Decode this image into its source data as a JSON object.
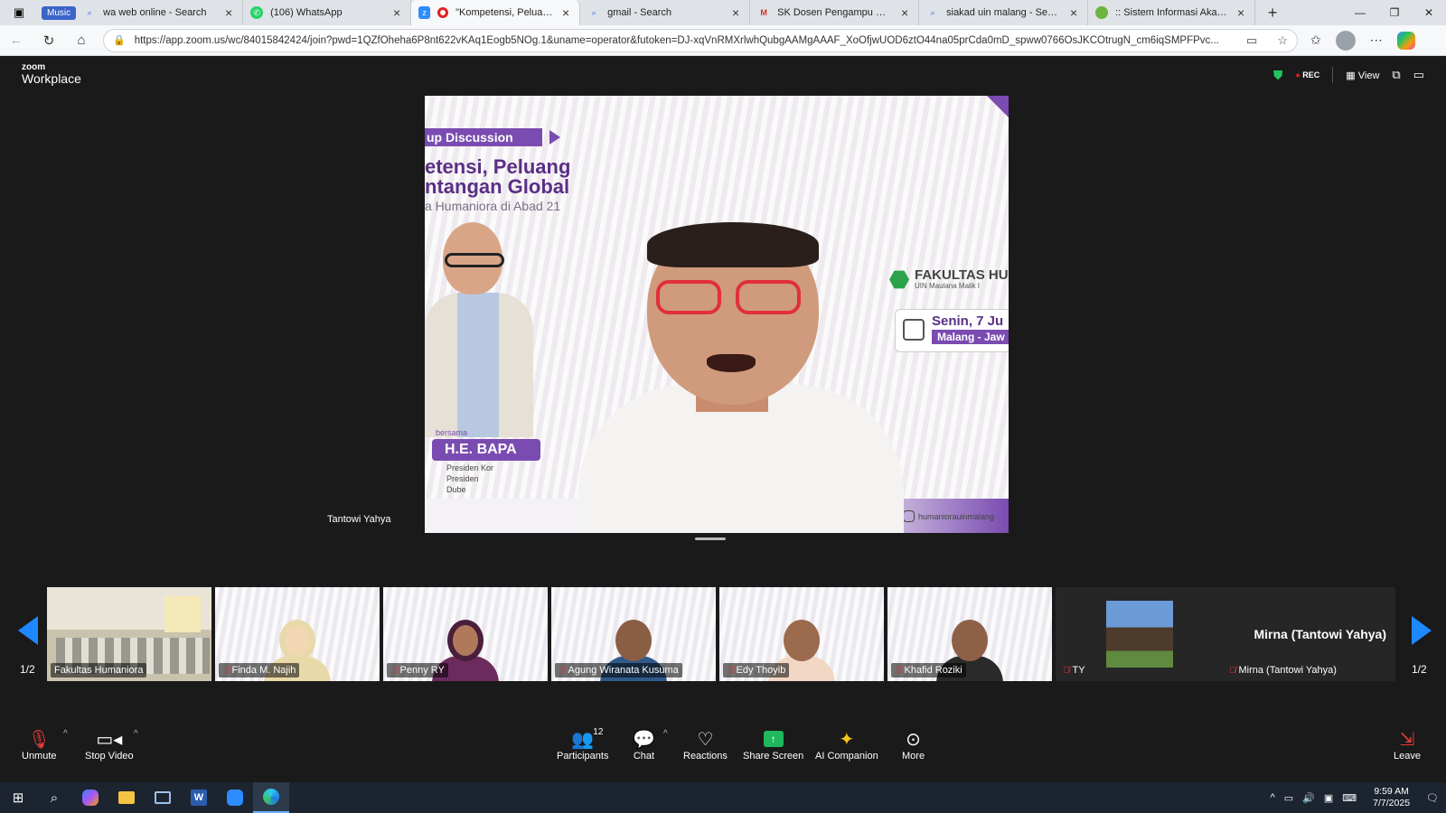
{
  "browser": {
    "music_label": "Music",
    "tabs": [
      {
        "label": "wa web online - Search",
        "icon": "search-icon"
      },
      {
        "label": "(106) WhatsApp",
        "icon": "whatsapp-icon"
      },
      {
        "label": "\"Kompetensi, Peluang dan",
        "icon": "zoom-recording-icon"
      },
      {
        "label": "gmail - Search",
        "icon": "search-icon"
      },
      {
        "label": "SK Dosen Pengampu MK Semes",
        "icon": "gmail-icon"
      },
      {
        "label": "siakad uin malang - Search",
        "icon": "search-icon"
      },
      {
        "label": ":: Sistem Informasi Akademik U",
        "icon": "uin-icon"
      }
    ],
    "url": "https://app.zoom.us/wc/84015842424/join?pwd=1QZfOheha6P8nt622vKAq1Eogb5NOg.1&uname=operator&futoken=DJ-xqVnRMXrlwhQubgAAMgAAAF_XoOfjwUOD6ztO44na05prCda0mD_spww0766OsJKCOtrugN_cm6iqSMPFPvc..."
  },
  "zoom": {
    "logo_small": "zoom",
    "logo_big": "Workplace",
    "rec_label": "REC",
    "view_label": "View",
    "main_speaker_name": "Tantowi Yahya",
    "slide": {
      "banner": "up Discussion",
      "title_line1": "etensi, Peluang",
      "title_line2": "ntangan Global",
      "subtitle": "a Humaniora di Abad 21",
      "faculty_title": "FAKULTAS HU",
      "faculty_sub": "UIN Maulana Malik I",
      "date": "Senin, 7 Ju",
      "place": "Malang - Jaw",
      "bersama": "bersama",
      "guest": "H.E. BAPA",
      "guest_lines": [
        "Presiden Kor",
        "Presiden",
        "Dube"
      ],
      "instagram": "humaniorauinmalang"
    },
    "gallery": [
      {
        "name": "Fakultas Humaniora",
        "muted": false
      },
      {
        "name": "Finda M. Najih",
        "muted": true
      },
      {
        "name": "Penny RY",
        "muted": true
      },
      {
        "name": "Agung Wiranata Kusuma",
        "muted": true
      },
      {
        "name": "Edy Thoyib",
        "muted": true
      },
      {
        "name": "Khafid Roziki",
        "muted": true
      },
      {
        "name": "TY",
        "muted": true
      },
      {
        "name": "Mirna (Tantowi Yahya)",
        "muted": true
      }
    ],
    "mirna_display_name": "Mirna (Tantowi Yahya)",
    "page_left": "1/2",
    "page_right": "1/2",
    "toolbar": {
      "unmute": "Unmute",
      "stop_video": "Stop Video",
      "participants": "Participants",
      "participants_count": "12",
      "chat": "Chat",
      "reactions": "Reactions",
      "share_screen": "Share Screen",
      "ai_companion": "AI Companion",
      "more": "More",
      "leave": "Leave"
    }
  },
  "taskbar": {
    "time": "9:59 AM",
    "date": "7/7/2025"
  },
  "colors": {
    "zoom_bg": "#1a1a1a",
    "slide_purple": "#7a4bb0",
    "share_green": "#1fb85c",
    "nav_arrow_blue": "#1e88ff"
  }
}
